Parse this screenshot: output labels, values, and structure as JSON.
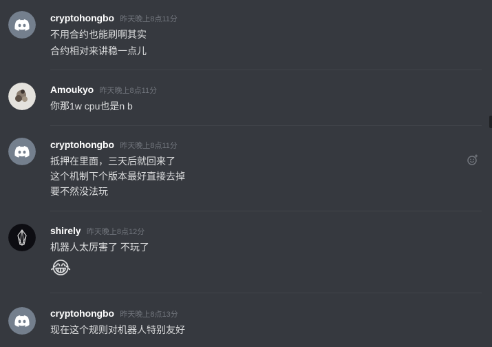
{
  "messages": [
    {
      "author": "cryptohongbo",
      "timestamp": "昨天晚上8点11分",
      "avatar_icon": "discord-logo-icon",
      "lines": [
        "不用合约也能刷啊其实",
        "合约相对来讲稳一点儿"
      ]
    },
    {
      "author": "Amoukyo",
      "timestamp": "昨天晚上8点11分",
      "avatar_icon": "user-photo-avatar",
      "lines": [
        "你那1w cpu也是n b"
      ]
    },
    {
      "author": "cryptohongbo",
      "timestamp": "昨天晚上8点11分",
      "avatar_icon": "discord-logo-icon",
      "lines": [
        "抵押在里面，三天后就回来了",
        "这个机制下个版本最好直接去掉",
        "要不然没法玩"
      ]
    },
    {
      "author": "shirely",
      "timestamp": "昨天晚上8点12分",
      "avatar_icon": "eos-logo-icon",
      "lines": [
        "机器人太厉害了  不玩了"
      ],
      "emoji": "😂"
    },
    {
      "author": "cryptohongbo",
      "timestamp": "昨天晚上8点13分",
      "avatar_icon": "discord-logo-icon",
      "lines": [
        "现在这个规则对机器人特别友好"
      ]
    }
  ],
  "colors": {
    "background": "#36393f",
    "author": "#ffffff",
    "timestamp": "#72767d",
    "message_text": "#dcddde",
    "divider": "#42454a",
    "discord_avatar_bg": "#747f8d"
  },
  "actions": {
    "add_reaction_icon": "add-reaction-icon"
  }
}
